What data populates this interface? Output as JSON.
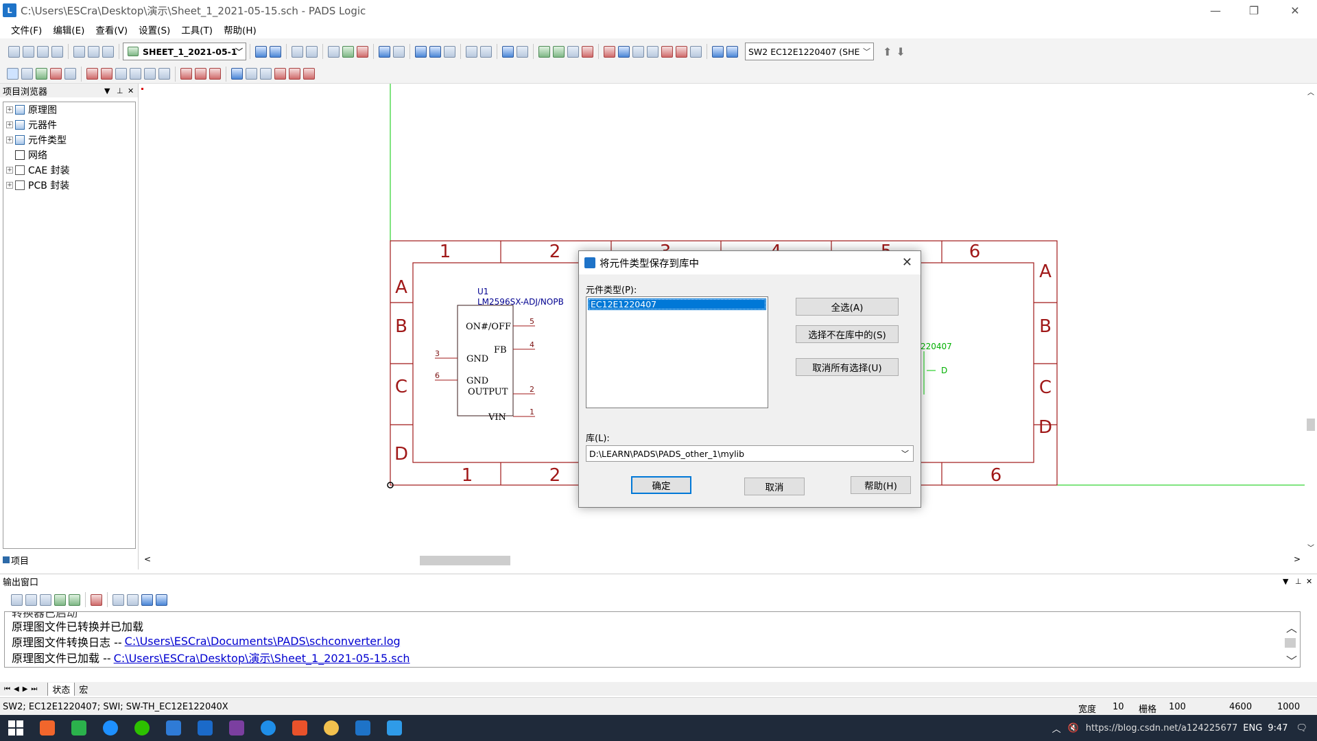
{
  "window": {
    "title": "C:\\Users\\ESCra\\Desktop\\演示\\Sheet_1_2021-05-15.sch - PADS Logic",
    "icon_name": "pads-logic-icon",
    "icon_text": "L"
  },
  "menu": [
    "文件(F)",
    "编辑(E)",
    "查看(V)",
    "设置(S)",
    "工具(T)",
    "帮助(H)"
  ],
  "toolbar": {
    "sheet_combo": "SHEET_1_2021-05-1",
    "part_combo": "SW2 EC12E1220407 (SHE"
  },
  "browser": {
    "title": "项目浏览器",
    "items": [
      "原理图",
      "元器件",
      "元件类型",
      "网络",
      "CAE 封装",
      "PCB 封装"
    ],
    "tab": "项目"
  },
  "schematic": {
    "col_labels": [
      "1",
      "2",
      "3",
      "4",
      "5",
      "6"
    ],
    "row_labels": [
      "A",
      "B",
      "C",
      "D"
    ],
    "ref": "U1",
    "part": "LM2596SX-ADJ/NOPB",
    "pins": [
      {
        "name": "ON#/OFF",
        "num": "5",
        "side": "right"
      },
      {
        "name": "FB",
        "num": "4",
        "side": "right"
      },
      {
        "name": "GND",
        "num": "3",
        "side": "left"
      },
      {
        "name": "GND",
        "num": "6",
        "side": "left"
      },
      {
        "name": "OUTPUT",
        "num": "2",
        "side": "right"
      },
      {
        "name": "VIN",
        "num": "1",
        "side": "right"
      }
    ],
    "green_text": "220407",
    "green_pin": "D",
    "frame_color": "#a01818",
    "wire_color": "#00c800"
  },
  "dialog": {
    "title": "将元件类型保存到库中",
    "list_label": "元件类型(P):",
    "list_items": [
      "EC12E1220407"
    ],
    "select_all": "全选(A)",
    "select_not_in_lib": "选择不在库中的(S)",
    "deselect_all": "取消所有选择(U)",
    "lib_label": "库(L):",
    "lib_value": "D:\\LEARN\\PADS\\PADS_other_1\\mylib",
    "ok": "确定",
    "cancel": "取消",
    "help": "帮助(H)"
  },
  "output": {
    "title": "输出窗口",
    "partial_line": "转换器已启动",
    "lines": [
      {
        "text": "原理图文件已转换并已加载",
        "link": ""
      },
      {
        "text": "原理图文件转换日志 --",
        "link": "C:\\Users\\ESCra\\Documents\\PADS\\schconverter.log"
      },
      {
        "text": "原理图文件已加载 --",
        "link": "C:\\Users\\ESCra\\Desktop\\演示\\Sheet_1_2021-05-15.sch"
      }
    ],
    "tabs": [
      "状态",
      "宏"
    ]
  },
  "status": {
    "left": "SW2; EC12E1220407; SWI; SW-TH_EC12E122040X",
    "width_label": "宽度",
    "width_value": "10",
    "grid_label": "栅格",
    "grid_value": "100",
    "x": "4600",
    "y": "1000"
  },
  "taskbar": {
    "tray_text": "https://blog.csdn.net/a124225677",
    "lang": "ENG",
    "time": "9:47"
  }
}
